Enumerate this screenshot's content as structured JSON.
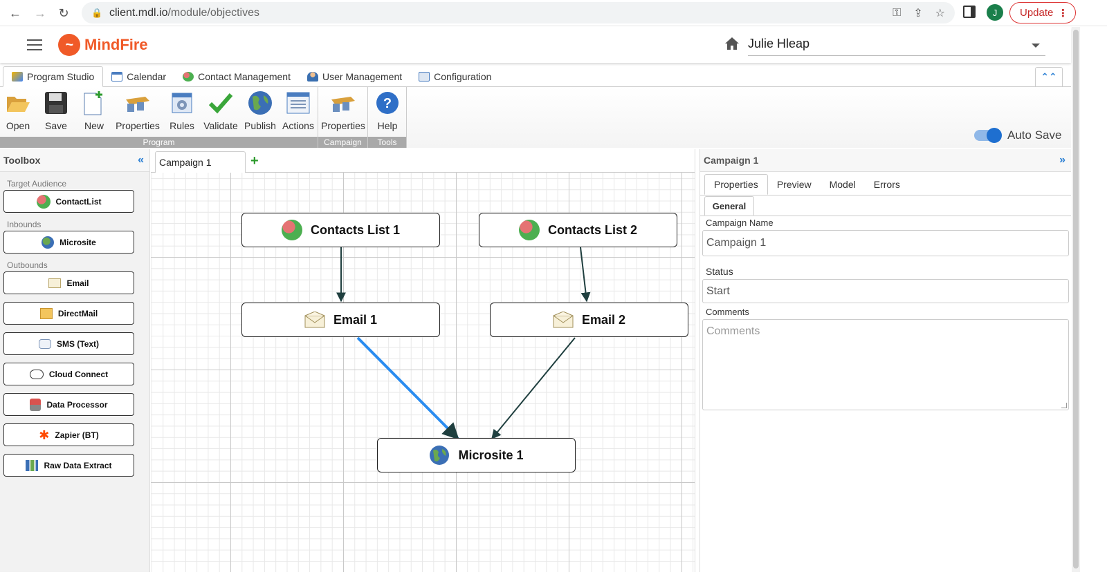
{
  "browser": {
    "url_host": "client.mdl.io",
    "url_path": "/module/objectives",
    "profile_initial": "J",
    "update_label": "Update"
  },
  "app": {
    "brand": "MindFire",
    "user_name": "Julie Hleap"
  },
  "main_tabs": [
    {
      "label": "Program Studio",
      "active": true,
      "icon": "program-studio-icon"
    },
    {
      "label": "Calendar",
      "active": false,
      "icon": "calendar-icon"
    },
    {
      "label": "Contact Management",
      "active": false,
      "icon": "contacts-icon"
    },
    {
      "label": "User Management",
      "active": false,
      "icon": "user-icon"
    },
    {
      "label": "Configuration",
      "active": false,
      "icon": "configuration-icon"
    }
  ],
  "ribbon": {
    "program_group": "Program",
    "campaign_group": "Campaign",
    "tools_group": "Tools",
    "buttons": {
      "open": "Open",
      "save": "Save",
      "new": "New",
      "properties": "Properties",
      "rules": "Rules",
      "validate": "Validate",
      "publish": "Publish",
      "actions": "Actions",
      "campaign_properties": "Properties",
      "help": "Help"
    },
    "autosave_label": "Auto Save",
    "autosave_on": true
  },
  "toolbox": {
    "title": "Toolbox",
    "sections": {
      "target": "Target Audience",
      "inbounds": "Inbounds",
      "outbounds": "Outbounds"
    },
    "items": {
      "contactlist": "ContactList",
      "microsite": "Microsite",
      "email": "Email",
      "directmail": "DirectMail",
      "sms": "SMS (Text)",
      "cloud": "Cloud Connect",
      "dataproc": "Data Processor",
      "zapier": "Zapier (BT)",
      "rawdata": "Raw Data Extract"
    }
  },
  "canvas": {
    "tab": "Campaign 1",
    "nodes": {
      "contacts1": "Contacts List 1",
      "contacts2": "Contacts List 2",
      "email1": "Email 1",
      "email2": "Email 2",
      "microsite1": "Microsite 1"
    },
    "selected_edge": "Email 1 → Microsite 1",
    "selected_edge_color": "#2a8cf0",
    "edge_color": "#1f3f3f"
  },
  "panel": {
    "title": "Campaign 1",
    "tabs": [
      "Properties",
      "Preview",
      "Model",
      "Errors"
    ],
    "sub_tab": "General",
    "campaign_name_label": "Campaign Name",
    "campaign_name_value": "Campaign 1",
    "status_label": "Status",
    "status_value": "Start",
    "comments_label": "Comments",
    "comments_placeholder": "Comments"
  }
}
